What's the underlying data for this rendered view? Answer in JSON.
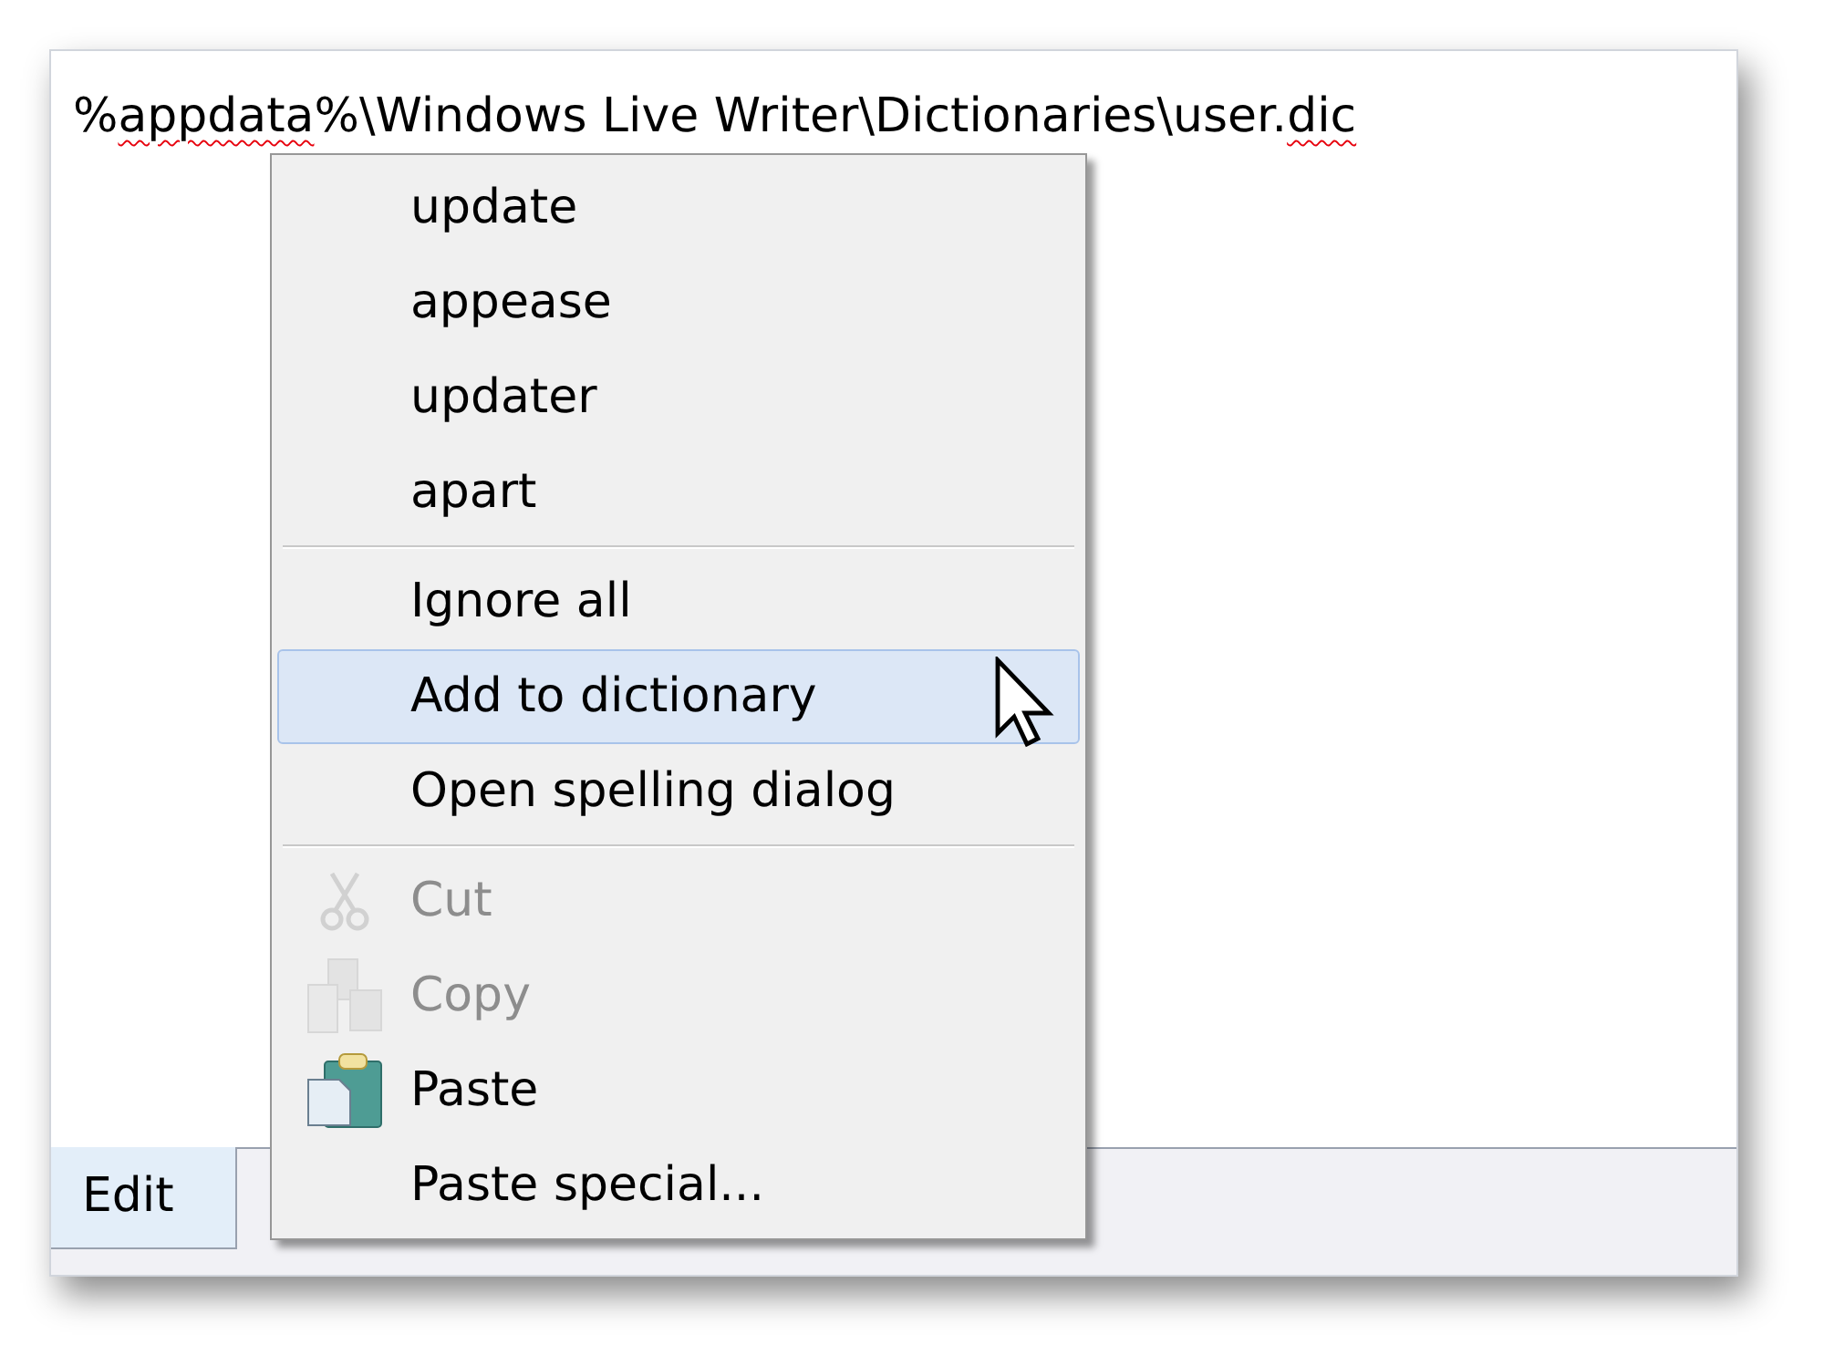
{
  "editor": {
    "segments": [
      {
        "text": "%",
        "misspelled": false
      },
      {
        "text": "appdata",
        "misspelled": true
      },
      {
        "text": "%\\Windows Live Writer\\Dictionaries\\user.",
        "misspelled": false
      },
      {
        "text": "dic",
        "misspelled": true
      }
    ]
  },
  "tabs": [
    {
      "label": "Edit",
      "selected": true
    }
  ],
  "context_menu": [
    {
      "kind": "item",
      "label": "update",
      "selected": false,
      "disabled": false
    },
    {
      "kind": "item",
      "label": "appease",
      "selected": false,
      "disabled": false
    },
    {
      "kind": "item",
      "label": "updater",
      "selected": false,
      "disabled": false
    },
    {
      "kind": "item",
      "label": "apart",
      "selected": false,
      "disabled": false
    },
    {
      "kind": "separator"
    },
    {
      "kind": "item",
      "label": "Ignore all",
      "selected": false,
      "disabled": false
    },
    {
      "kind": "item",
      "label": "Add to dictionary",
      "selected": true,
      "disabled": false
    },
    {
      "kind": "item",
      "label": "Open spelling dialog",
      "selected": false,
      "disabled": false
    },
    {
      "kind": "separator"
    },
    {
      "kind": "cut",
      "label": "Cut",
      "selected": false,
      "disabled": true
    },
    {
      "kind": "copy",
      "label": "Copy",
      "selected": false,
      "disabled": true
    },
    {
      "kind": "paste",
      "label": "Paste",
      "selected": false,
      "disabled": false
    },
    {
      "kind": "item",
      "label": "Paste special...",
      "selected": false,
      "disabled": false
    }
  ]
}
